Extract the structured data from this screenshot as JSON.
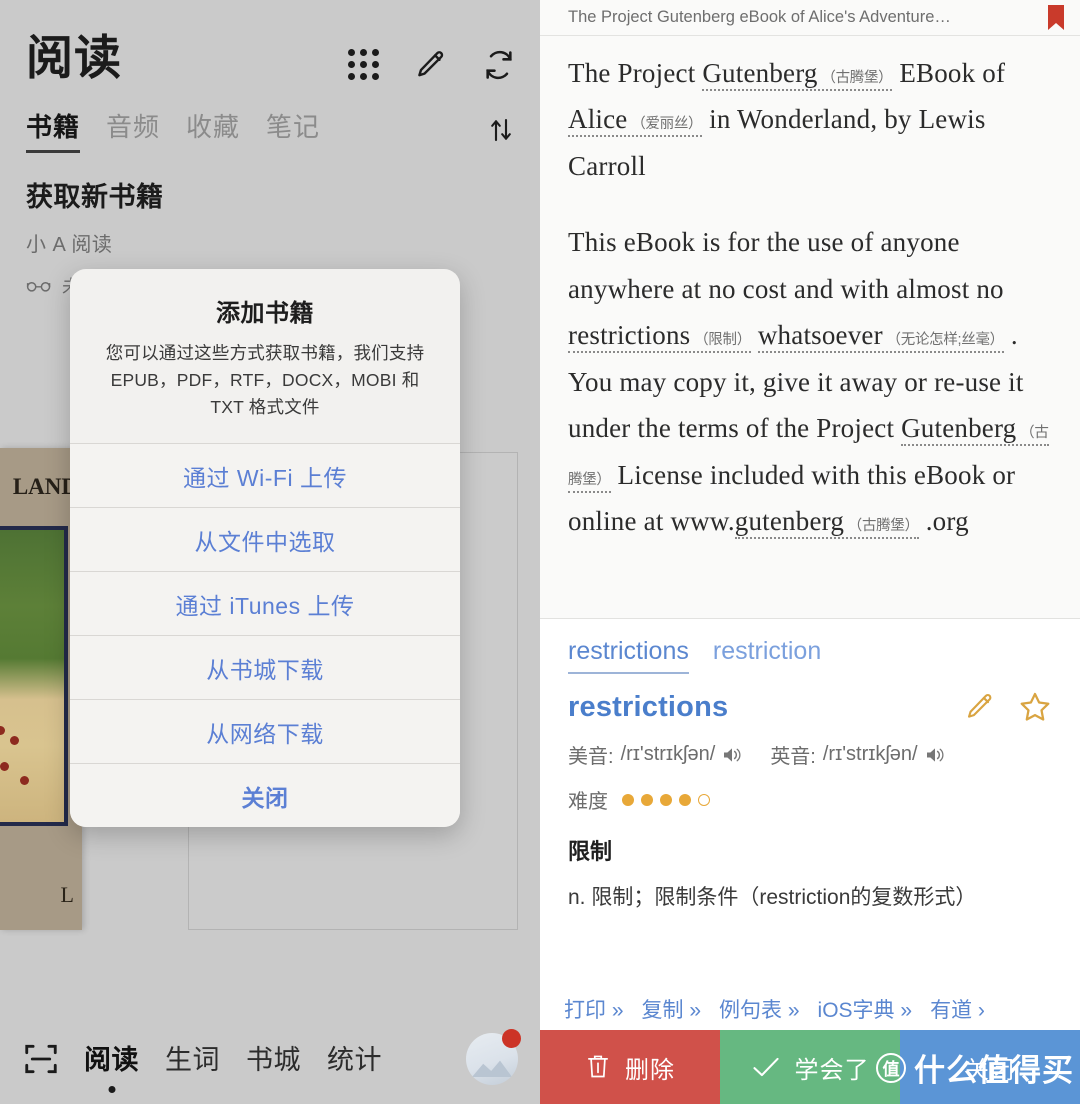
{
  "colors": {
    "left_panel_bg": "#cacaca",
    "right_panel_bg": "#fafaf9",
    "accent_blue": "#5b87d0",
    "dict_gold": "#e8a838",
    "delete_red": "#d0514a",
    "learned_green": "#66b881",
    "close_blue": "#5b95d6",
    "bookmark_red": "#c93a2b"
  },
  "left": {
    "title": "阅读",
    "header_icons": [
      {
        "name": "grid-icon",
        "label": "grid"
      },
      {
        "name": "pencil-icon",
        "label": "edit"
      },
      {
        "name": "refresh-icon",
        "label": "refresh"
      }
    ],
    "tabs": [
      {
        "label": "书籍",
        "active": true
      },
      {
        "label": "音频",
        "active": false
      },
      {
        "label": "收藏",
        "active": false
      },
      {
        "label": "笔记",
        "active": false
      }
    ],
    "sort_icon": "sort-updown-icon",
    "section": {
      "title": "获取新书籍",
      "subtitle": "小 A 阅读",
      "meta_icon": "glasses-icon",
      "meta_text": "未"
    },
    "book_cover": {
      "title_fragment": "LAND",
      "bottom_letter": "L"
    },
    "bottom_nav": {
      "scan_icon": "scan-frame-icon",
      "items": [
        {
          "label": "阅读",
          "active": true
        },
        {
          "label": "生词",
          "active": false
        },
        {
          "label": "书城",
          "active": false
        },
        {
          "label": "统计",
          "active": false
        }
      ],
      "avatar_name": "avatar",
      "avatar_badge": true
    }
  },
  "modal": {
    "title": "添加书籍",
    "description": "您可以通过这些方式获取书籍，我们支持 EPUB，PDF，RTF，DOCX，MOBI 和 TXT 格式文件",
    "buttons": [
      {
        "label": "通过 Wi-Fi 上传",
        "name": "upload-via-wifi-button"
      },
      {
        "label": "从文件中选取",
        "name": "pick-from-files-button"
      },
      {
        "label": "通过 iTunes 上传",
        "name": "upload-via-itunes-button"
      },
      {
        "label": "从书城下载",
        "name": "download-from-store-button"
      },
      {
        "label": "从网络下载",
        "name": "download-from-web-button"
      },
      {
        "label": "关闭",
        "name": "close-button"
      }
    ]
  },
  "right": {
    "header": {
      "title": "The Project Gutenberg eBook of Alice's Adventure…",
      "bookmark_icon": "bookmark-icon"
    },
    "reader": {
      "paragraphs": [
        {
          "id": "title-paragraph",
          "runs": [
            {
              "t": "text",
              "v": "The Project "
            },
            {
              "t": "ann",
              "v": "Gutenberg",
              "gloss": "（古腾堡）"
            },
            {
              "t": "text",
              "v": " EBook of "
            },
            {
              "t": "ann",
              "v": "Alice",
              "gloss": "（爱丽丝）"
            },
            {
              "t": "text",
              "v": " in Wonderland, by Lewis Carroll"
            }
          ]
        },
        {
          "id": "body-paragraph",
          "runs": [
            {
              "t": "text",
              "v": "This eBook is for the use of anyone anywhere at no cost and with almost no "
            },
            {
              "t": "ann",
              "v": "restrictions",
              "gloss": "（限制）"
            },
            {
              "t": "text",
              "v": " "
            },
            {
              "t": "ann",
              "v": "whatsoever",
              "gloss": "（无论怎样;丝毫）"
            },
            {
              "t": "text",
              "v": " . You may copy it, give it away or re-use it under the terms of the Project "
            },
            {
              "t": "ann",
              "v": "Gutenberg",
              "gloss": "（古腾堡）"
            },
            {
              "t": "text",
              "v": " License included with this eBook or online at www."
            },
            {
              "t": "ann",
              "v": "gutenberg",
              "gloss": "（古腾堡）"
            },
            {
              "t": "text",
              "v": " .org"
            }
          ]
        }
      ]
    },
    "dictionary": {
      "tabs": [
        {
          "label": "restrictions",
          "active": true
        },
        {
          "label": "restriction",
          "active": false
        }
      ],
      "headword": "restrictions",
      "head_icons": [
        {
          "name": "edit-pencil-icon"
        },
        {
          "name": "star-icon"
        }
      ],
      "pronunciations": [
        {
          "label": "美音:",
          "ipa": "/rɪ'strɪkʃən/",
          "speaker_icon": "speaker-icon"
        },
        {
          "label": "英音:",
          "ipa": "/rɪ'strɪkʃən/",
          "speaker_icon": "speaker-icon"
        }
      ],
      "difficulty": {
        "label": "难度",
        "filled": 4,
        "total": 5
      },
      "sense": "限制",
      "definition": "n. 限制；限制条件（restriction的复数形式）",
      "links": [
        {
          "label": "打印 »",
          "name": "print-link"
        },
        {
          "label": "复制 »",
          "name": "copy-link"
        },
        {
          "label": "例句表 »",
          "name": "examples-link"
        },
        {
          "label": "iOS字典 »",
          "name": "ios-dictionary-link"
        },
        {
          "label": "有道 ›",
          "name": "youdao-link"
        }
      ]
    },
    "actions": [
      {
        "label": "删除",
        "name": "delete-button",
        "icon": "trash-icon",
        "color": "#d0514a"
      },
      {
        "label": "学会了",
        "name": "learned-button",
        "icon": "check-icon",
        "color": "#66b881"
      },
      {
        "label": "关闭",
        "name": "close-action-button",
        "icon": "none",
        "color": "#5b95d6"
      }
    ],
    "watermark": {
      "badge": "值",
      "text": "什么值得买"
    }
  }
}
